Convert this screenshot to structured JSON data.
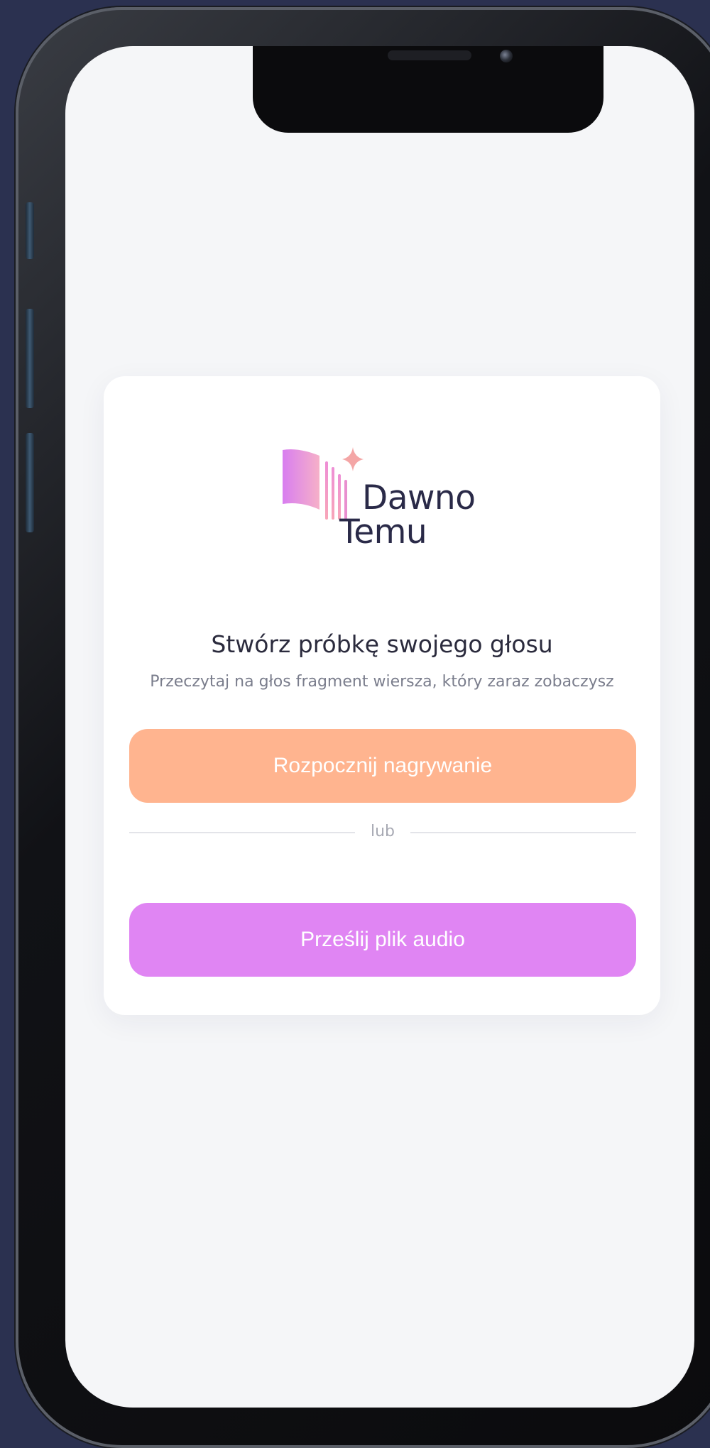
{
  "brand": {
    "line1": "Dawno",
    "line2": "Temu"
  },
  "voice_sample": {
    "title": "Stwórz próbkę swojego głosu",
    "subtitle": "Przeczytaj na głos fragment wiersza, który zaraz zobaczysz",
    "record_button": "Rozpocznij nagrywanie",
    "divider_text": "lub",
    "upload_button": "Prześlij plik audio"
  },
  "colors": {
    "record_button": "#ffb48f",
    "upload_button": "#e085f3",
    "screen_background": "#f5f6f8",
    "brand_text": "#2a2a48"
  },
  "icons": [
    "book-logo-icon",
    "sparkle-icon"
  ]
}
